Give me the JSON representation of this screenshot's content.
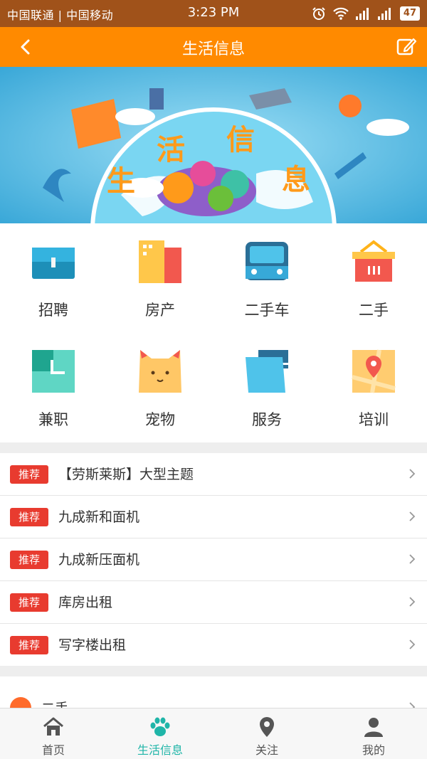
{
  "status_bar": {
    "carrier": "中国联通 | 中国移动",
    "time": "3:23 PM",
    "battery": "47"
  },
  "header": {
    "title": "生活信息",
    "back_icon": "chevron-left-icon",
    "edit_icon": "edit-icon"
  },
  "banner": {
    "chars": [
      "生",
      "活",
      "信",
      "息"
    ]
  },
  "categories": [
    {
      "label": "招聘",
      "icon": "briefcase-icon"
    },
    {
      "label": "房产",
      "icon": "building-icon"
    },
    {
      "label": "二手车",
      "icon": "bus-icon"
    },
    {
      "label": "二手",
      "icon": "basket-icon"
    },
    {
      "label": "兼职",
      "icon": "clock-icon"
    },
    {
      "label": "宠物",
      "icon": "cat-icon"
    },
    {
      "label": "服务",
      "icon": "box-icon"
    },
    {
      "label": "培训",
      "icon": "map-pin-icon"
    }
  ],
  "recommend": {
    "tag": "推荐",
    "items": [
      "【劳斯莱斯】大型主题",
      "九成新和面机",
      "九成新压面机",
      "库房出租",
      "写字楼出租"
    ]
  },
  "partial_section": {
    "label": "二手"
  },
  "tabbar": {
    "items": [
      {
        "label": "首页",
        "icon": "home-icon"
      },
      {
        "label": "生活信息",
        "icon": "paw-icon"
      },
      {
        "label": "关注",
        "icon": "location-icon"
      },
      {
        "label": "我的",
        "icon": "user-icon"
      }
    ],
    "active_index": 1
  },
  "colors": {
    "header": "#ff8a00",
    "status_bar": "#a0521a",
    "tag": "#e83b2f",
    "active_tab": "#1fb5a8"
  }
}
